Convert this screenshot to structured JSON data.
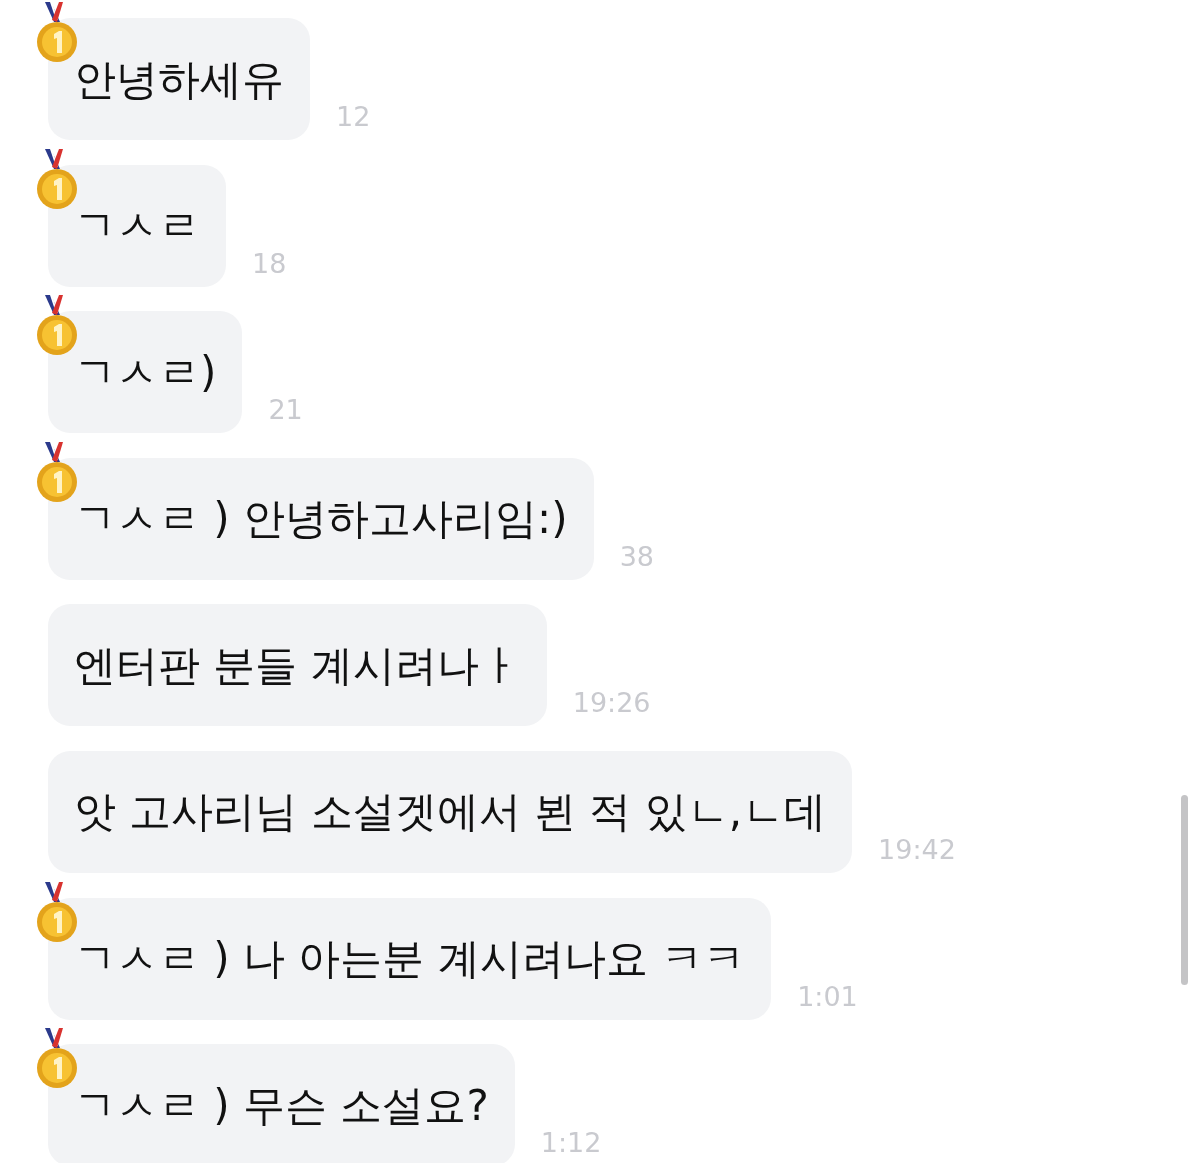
{
  "messages": [
    {
      "text": "안녕하세유",
      "time": "12",
      "medal": true
    },
    {
      "text": "ㄱㅅㄹ",
      "time": "18",
      "medal": true
    },
    {
      "text": "ㄱㅅㄹ)",
      "time": "21",
      "medal": true
    },
    {
      "text": "ㄱㅅㄹ ) 안녕하고사리임:)",
      "time": "38",
      "medal": true
    },
    {
      "text": "엔터판 분들 계시려나ㅏ",
      "time": "19:26",
      "medal": false
    },
    {
      "text": "앗 고사리님 소설겟에서 뵌 적 있ㄴ,ㄴ데",
      "time": "19:42",
      "medal": false
    },
    {
      "text": "ㄱㅅㄹ ) 나 아는분 계시려나요 ㅋㅋ",
      "time": "1:01",
      "medal": true
    },
    {
      "text": "ㄱㅅㄹ ) 무슨 소설요?",
      "time": "1:12",
      "medal": true
    }
  ]
}
